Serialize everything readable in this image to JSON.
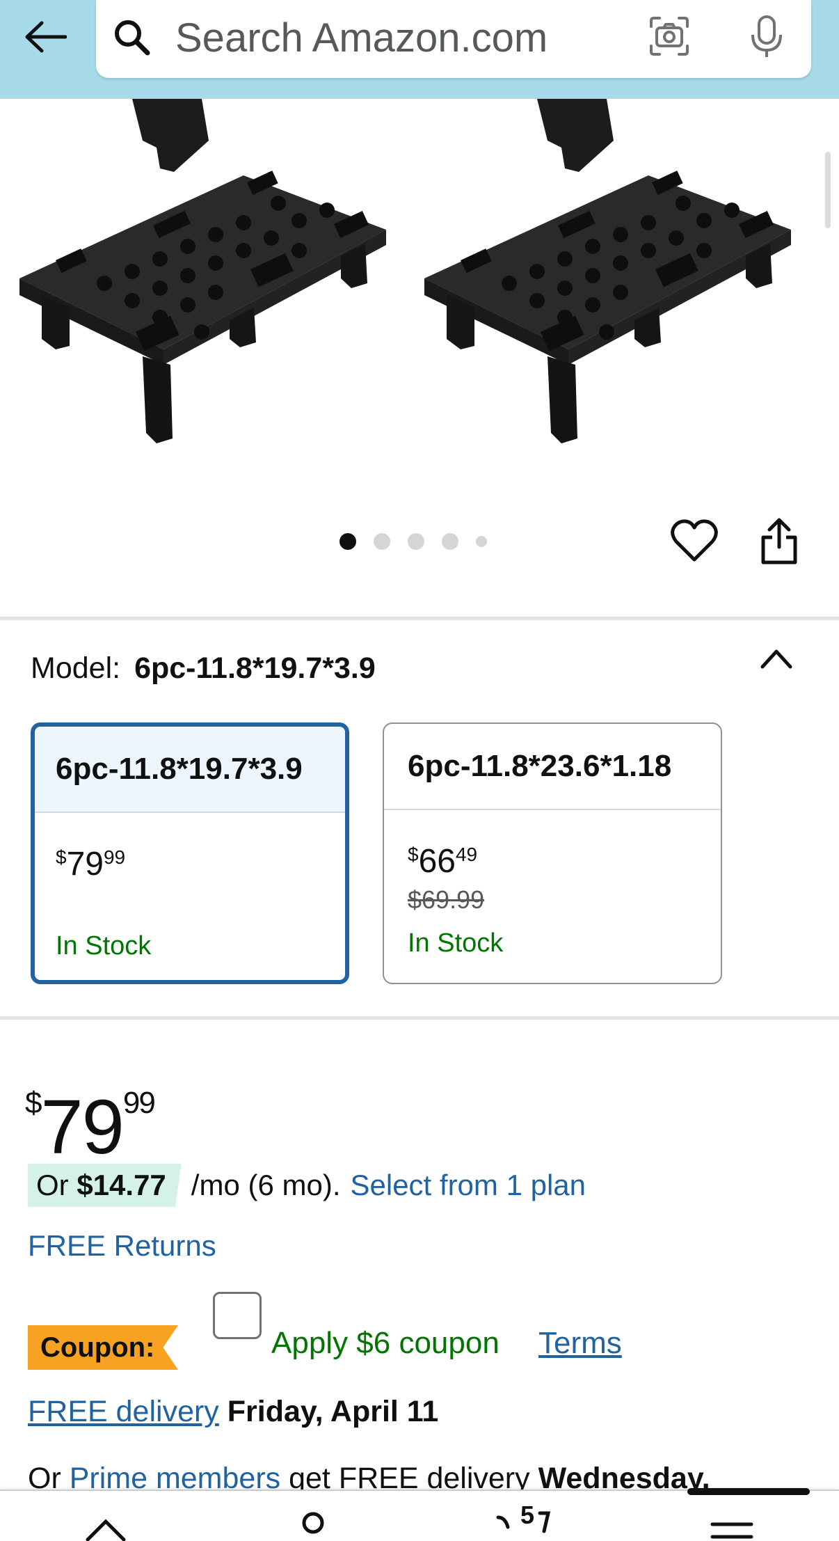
{
  "header": {
    "search_placeholder": "Search Amazon.com"
  },
  "gallery": {
    "image_count": 5,
    "active_index": 0
  },
  "model": {
    "label": "Model:",
    "selected_value": "6pc-11.8*19.7*3.9",
    "options": [
      {
        "name": "6pc-11.8*19.7*3.9",
        "price_symbol": "$",
        "price_whole": "79",
        "price_cents": "99",
        "list_price": "",
        "stock": "In Stock",
        "selected": true
      },
      {
        "name": "6pc-11.8*23.6*1.18",
        "price_symbol": "$",
        "price_whole": "66",
        "price_cents": "49",
        "list_price": "$69.99",
        "stock": "In Stock",
        "selected": false
      }
    ]
  },
  "price": {
    "symbol": "$",
    "whole": "79",
    "cents": "99"
  },
  "installment": {
    "prefix": "Or ",
    "amount": "$14.77",
    "suffix": "/mo (6 mo).",
    "link": "Select from 1 plan"
  },
  "free_returns": "FREE Returns",
  "coupon": {
    "badge": "Coupon:",
    "apply_text": "Apply $6 coupon",
    "terms": "Terms"
  },
  "delivery": {
    "link": "FREE delivery",
    "date": "Friday, April 11"
  },
  "prime": {
    "prefix": "Or ",
    "link": "Prime members",
    "middle": " get FREE delivery ",
    "date": "Wednesday,"
  },
  "bottom_nav": {
    "cart_count": "5"
  },
  "colors": {
    "header_bg": "#a8dbe9",
    "link": "#2162a1",
    "in_stock": "#007600",
    "coupon": "#f7a223",
    "installment_bg": "#d4f2e6"
  }
}
